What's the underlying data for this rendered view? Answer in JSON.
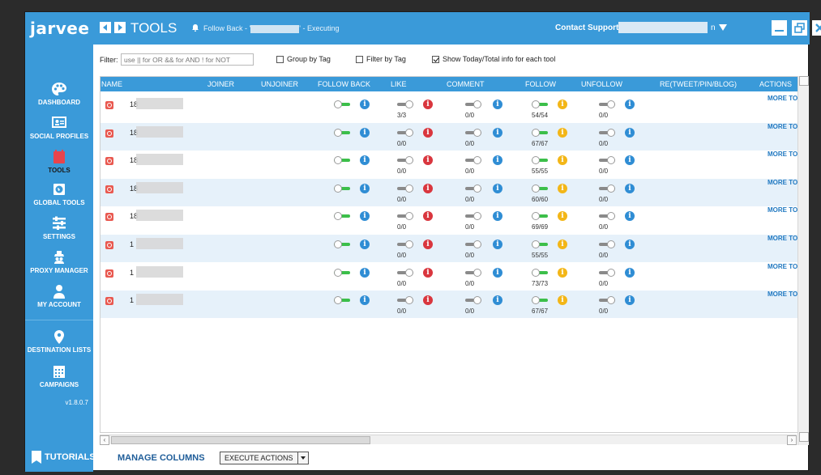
{
  "app": {
    "logo": "jarvee",
    "version": "v1.8.0.7"
  },
  "header": {
    "title": "TOOLS",
    "status_prefix": "Follow Back - '",
    "status_suffix": "' - Executing",
    "support": "Contact Support",
    "account_suffix": "n"
  },
  "sidebar": {
    "items": [
      {
        "label": "DASHBOARD",
        "icon": "palette-icon"
      },
      {
        "label": "SOCIAL PROFILES",
        "icon": "profile-card-icon"
      },
      {
        "label": "TOOLS",
        "icon": "calendar-icon"
      },
      {
        "label": "GLOBAL TOOLS",
        "icon": "globe-icon"
      },
      {
        "label": "SETTINGS",
        "icon": "sliders-icon"
      },
      {
        "label": "PROXY MANAGER",
        "icon": "spy-icon"
      },
      {
        "label": "MY ACCOUNT",
        "icon": "user-icon"
      },
      {
        "label": "DESTINATION LISTS",
        "icon": "location-pin-icon"
      },
      {
        "label": "CAMPAIGNS",
        "icon": "calendar-grid-icon"
      }
    ],
    "tutorials": "TUTORIALS"
  },
  "filter": {
    "label": "Filter:",
    "placeholder": "use || for OR && for AND ! for NOT",
    "group_by_tag": "Group by Tag",
    "filter_by_tag": "Filter by Tag",
    "show_today_total": "Show Today/Total info for each tool"
  },
  "columns": [
    "NAME",
    "JOINER",
    "UNJOINER",
    "FOLLOW BACK",
    "LIKE",
    "COMMENT",
    "FOLLOW",
    "UNFOLLOW",
    "RE(TWEET/PIN/BLOG)",
    "ACTIONS"
  ],
  "rows": [
    {
      "name": "18",
      "like": "3/3",
      "comment": "0/0",
      "follow": "54/54",
      "unfollow": "0/0",
      "action": "MORE TOO"
    },
    {
      "name": "18",
      "like": "0/0",
      "comment": "0/0",
      "follow": "67/67",
      "unfollow": "0/0",
      "action": "MORE TOO"
    },
    {
      "name": "18",
      "like": "0/0",
      "comment": "0/0",
      "follow": "55/55",
      "unfollow": "0/0",
      "action": "MORE TOO"
    },
    {
      "name": "18",
      "like": "0/0",
      "comment": "0/0",
      "follow": "60/60",
      "unfollow": "0/0",
      "action": "MORE TOO"
    },
    {
      "name": "18",
      "like": "0/0",
      "comment": "0/0",
      "follow": "69/69",
      "unfollow": "0/0",
      "action": "MORE TOO"
    },
    {
      "name": "1",
      "like": "0/0",
      "comment": "0/0",
      "follow": "55/55",
      "unfollow": "0/0",
      "action": "MORE TOO"
    },
    {
      "name": "1",
      "like": "0/0",
      "comment": "0/0",
      "follow": "73/73",
      "unfollow": "0/0",
      "action": "MORE TOO"
    },
    {
      "name": "1",
      "like": "0/0",
      "comment": "0/0",
      "follow": "67/67",
      "unfollow": "0/0",
      "action": "MORE TOO"
    }
  ],
  "footer": {
    "manage_columns": "MANAGE COLUMNS",
    "execute_actions": "EXECUTE ACTIONS"
  },
  "colors": {
    "accent": "#3a9ad9",
    "toggle_on": "#3cbf4a",
    "info_blue": "#2f8dd4",
    "info_red": "#d9363e",
    "info_orange": "#f3b617",
    "row_alt": "#e6f1fa"
  }
}
